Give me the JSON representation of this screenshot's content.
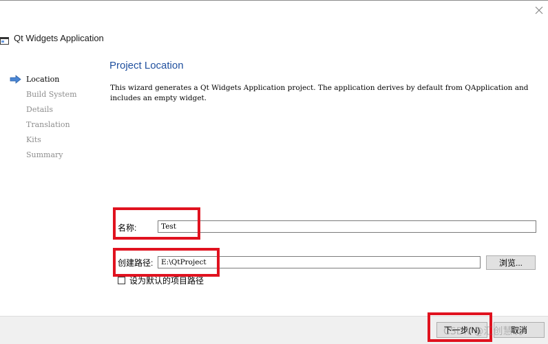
{
  "window": {
    "title": "Qt Widgets Application"
  },
  "steps": [
    {
      "label": "Location",
      "active": true
    },
    {
      "label": "Build System",
      "active": false
    },
    {
      "label": "Details",
      "active": false
    },
    {
      "label": "Translation",
      "active": false
    },
    {
      "label": "Kits",
      "active": false
    },
    {
      "label": "Summary",
      "active": false
    }
  ],
  "page": {
    "heading": "Project Location",
    "description": "This wizard generates a Qt Widgets Application project. The application derives by default from QApplication and includes an empty widget."
  },
  "form": {
    "name_label": "名称:",
    "name_value": "Test",
    "path_label": "创建路径:",
    "path_value": "E:\\QtProject",
    "browse_label": "浏览...",
    "default_path_label": "设为默认的项目路径",
    "default_path_checked": false
  },
  "buttons": {
    "next_label": "下一步(N)",
    "cancel_label": "取消"
  },
  "watermark": "CSDN @汇创慧玩",
  "colors": {
    "heading": "#1f4f9e",
    "highlight": "#e0121f",
    "step_arrow": "#4a86d4"
  }
}
